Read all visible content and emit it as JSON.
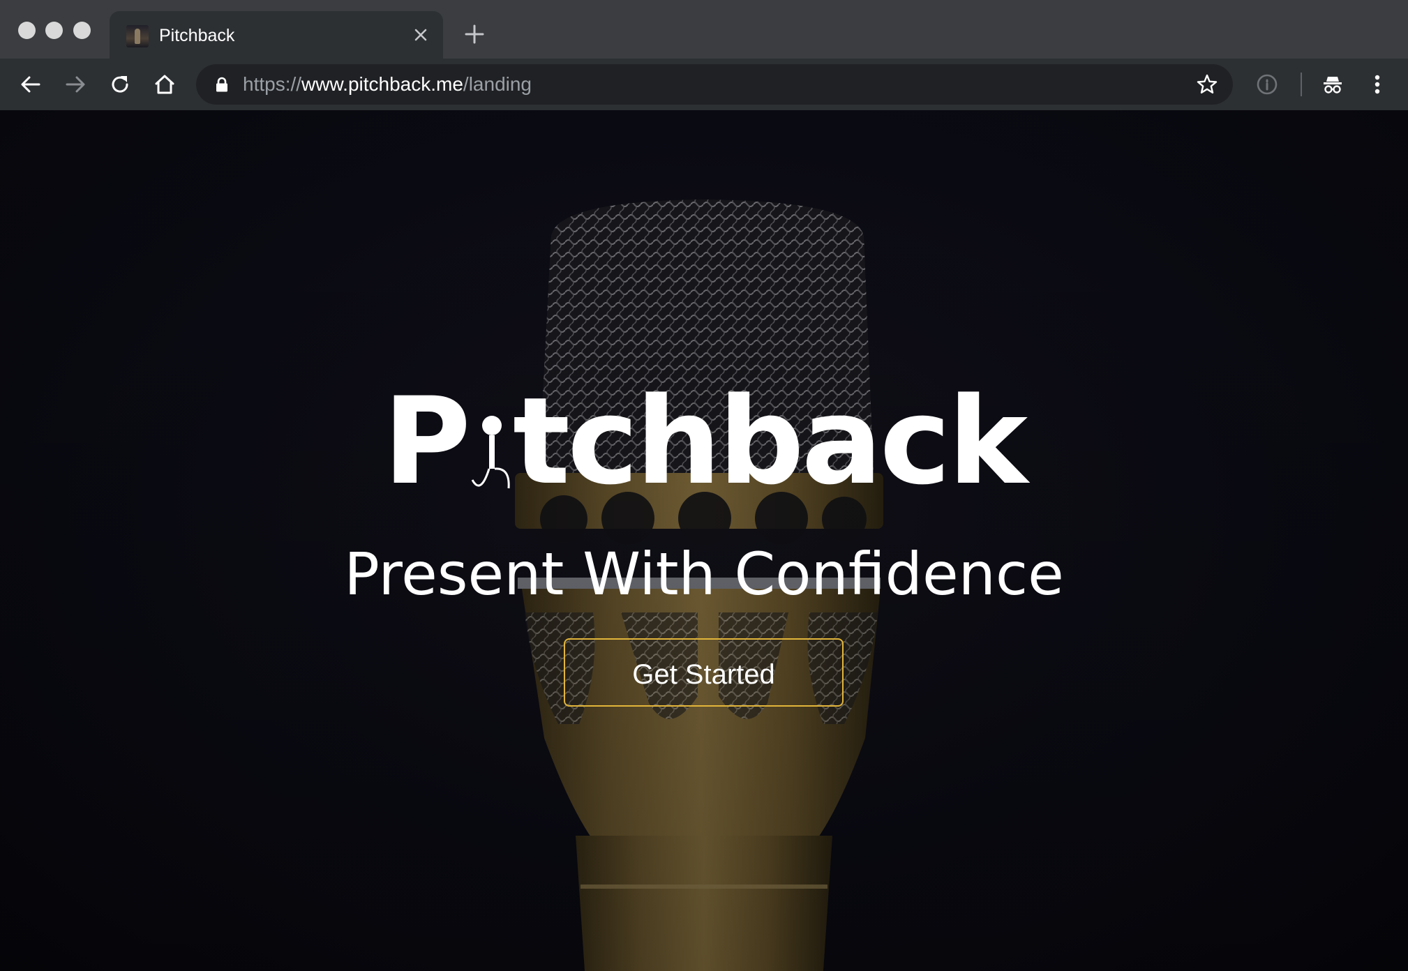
{
  "browser": {
    "tab": {
      "title": "Pitchback",
      "favicon": "pitchback-mic-favicon"
    },
    "address_bar": {
      "scheme": "https://",
      "host": "www.pitchback.me",
      "path": "/landing"
    },
    "icons": {
      "back": "back-arrow-icon",
      "forward": "forward-arrow-icon",
      "reload": "reload-icon",
      "home": "home-icon",
      "lock": "lock-icon",
      "bookmark": "star-icon",
      "info": "info-icon",
      "incognito": "incognito-icon",
      "menu": "kebab-menu-icon",
      "close_tab": "close-icon",
      "new_tab": "plus-icon"
    },
    "colors": {
      "tabstrip": "#3b3d40",
      "toolbar": "#2d3033",
      "omnibox": "#202124"
    }
  },
  "page": {
    "logo_text": "Pitchback",
    "logo_parts": {
      "before": "P",
      "after": "tchback"
    },
    "tagline": "Present With Confidence",
    "cta_label": "Get Started",
    "colors": {
      "cta_border": "#e2b53a",
      "text": "#ffffff",
      "background": "#0b0b14",
      "mic_body": "#7a6434"
    }
  }
}
